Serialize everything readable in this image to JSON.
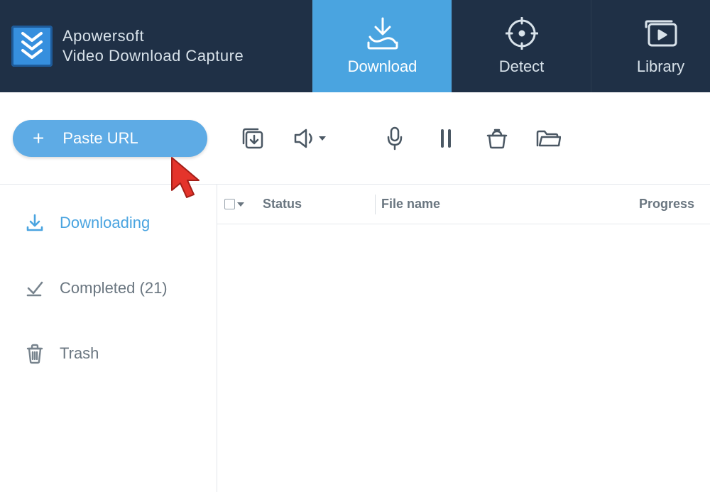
{
  "brand": {
    "line1": "Apowersoft",
    "line2": "Video Download Capture"
  },
  "tabs": {
    "download": "Download",
    "detect": "Detect",
    "library": "Library"
  },
  "toolbar": {
    "paste_url": "Paste URL"
  },
  "sidebar": {
    "downloading": "Downloading",
    "completed": "Completed (21)",
    "trash": "Trash"
  },
  "table": {
    "status": "Status",
    "file_name": "File name",
    "progress": "Progress"
  },
  "icons": {
    "download_tray": "download-tray-icon",
    "detect": "crosshair-icon",
    "library": "play-folder-icon",
    "batch": "batch-download-icon",
    "volume": "volume-icon",
    "record": "record-mic-icon",
    "pause": "pause-icon",
    "delete": "delete-icon",
    "open_folder": "open-folder-icon",
    "downloading_side": "download-icon",
    "completed_side": "check-icon",
    "trash_side": "trash-icon"
  }
}
